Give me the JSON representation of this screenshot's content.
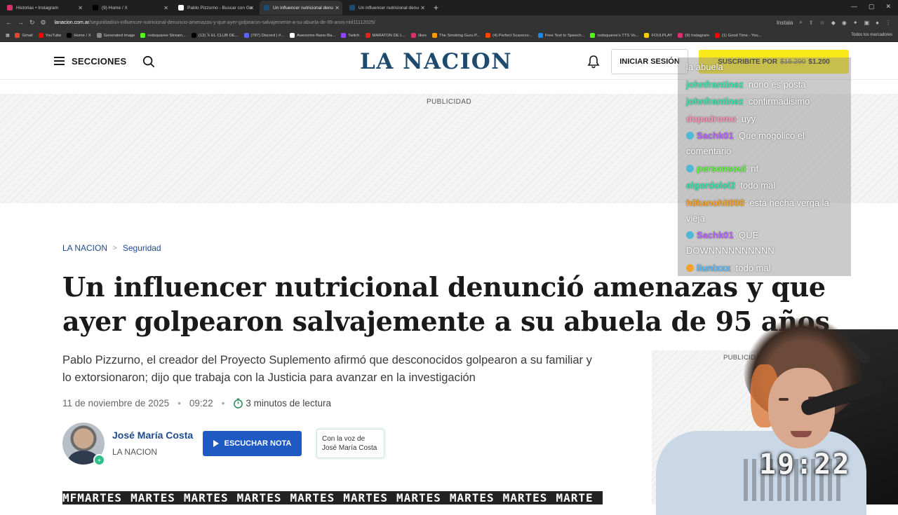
{
  "browser": {
    "tabs": [
      {
        "label": "Historias • Instagram",
        "color": "#d6306e"
      },
      {
        "label": "(9) Home / X",
        "color": "#000000"
      },
      {
        "label": "Pablo Pizzurno - Buscar con Go",
        "color": "#ffffff"
      },
      {
        "label": "Un influencer nutricional denu",
        "color": "#1e4a6e",
        "active": true
      },
      {
        "label": "Un influencer nutricional denu",
        "color": "#1e4a6e"
      }
    ],
    "new_tab": "+",
    "url_host": "lanacion.com.ar",
    "url_path": "/seguridad/un-influencer-nutricional-denuncio-amenazas-y-que-ayer-golpearon-salvajemente-a-su-abuela-de-95-anos-nid11112025/",
    "install_label": "Instala",
    "bookmarks": [
      {
        "label": "Gmail",
        "color": "#ea4335"
      },
      {
        "label": "YouTube",
        "color": "#ff0000"
      },
      {
        "label": "Home / X",
        "color": "#000000"
      },
      {
        "label": "Generated image",
        "color": "#888888"
      },
      {
        "label": "rodsquaree Stream...",
        "color": "#53fc18"
      },
      {
        "label": "(13) 𝕏 EL CLUB DE...",
        "color": "#000000"
      },
      {
        "label": "(787) Discord | #...",
        "color": "#5865f2"
      },
      {
        "label": "Awesome-Nano-Ba...",
        "color": "#ffffff"
      },
      {
        "label": "Twitch",
        "color": "#9146ff"
      },
      {
        "label": "MARATON DE L...",
        "color": "#e2231a"
      },
      {
        "label": "likes",
        "color": "#d6306e"
      },
      {
        "label": "The Smoking Guru P...",
        "color": "#ff9900"
      },
      {
        "label": "(4) Perfect Scarecro...",
        "color": "#ff4500"
      },
      {
        "label": "Free Text to Speech...",
        "color": "#1e88e5"
      },
      {
        "label": "rodsquaree's TTS Vo...",
        "color": "#53fc18"
      },
      {
        "label": "FOULPLAY",
        "color": "#ffcc00"
      },
      {
        "label": "(9) Instagram",
        "color": "#d6306e"
      },
      {
        "label": "(1) Good Time - You...",
        "color": "#ff0000"
      }
    ],
    "all_bookmarks": "Todos los marcadores"
  },
  "header": {
    "sections_label": "SECCIONES",
    "logo": "LA NACION",
    "login_label": "INICIAR SESIÓN",
    "subscribe_label": "SUSCRIBITE POR",
    "subscribe_old_price": "$15.290",
    "subscribe_price": "$1.200"
  },
  "ad": {
    "label": "PUBLICIDAD",
    "side_label": "PUBLICIDAD"
  },
  "article": {
    "breadcrumb": [
      "LA NACION",
      "Seguridad"
    ],
    "title": "Un influencer nutricional denunció amenazas y que ayer golpearon salvajemente a su abuela de 95 años",
    "subtitle": "Pablo Pizzurno, el creador del Proyecto Suplemento afirmó que desconocidos golpearon a su familiar y lo extorsionaron; dijo que trabaja con la Justicia para avanzar en la investigación",
    "date": "11 de noviembre de 2025",
    "time": "09:22",
    "reading_time": "3 minutos de lectura",
    "author_name": "José María Costa",
    "author_org": "LA NACION",
    "listen_label": "ESCUCHAR NOTA",
    "voice_line1": "Con la voz de",
    "voice_line2": "José María Costa",
    "ticker_words": [
      "MFMARTES",
      "MARTES",
      "MARTES",
      "MARTES",
      "MARTES",
      "MARTES",
      "MARTES",
      "MARTES",
      "MARTES",
      "MARTE"
    ]
  },
  "chat": {
    "messages": [
      {
        "user": "",
        "text": "la abuela",
        "color": "#ffffff"
      },
      {
        "user": "johnfrantinez",
        "text": ": nono es posta",
        "color": "#2ee8a8"
      },
      {
        "user": "johnfrantinez",
        "text": ": confirmadisimo",
        "color": "#2ee8a8"
      },
      {
        "user": "dopadromo",
        "text": ": uyy",
        "color": "#ff8fb5"
      },
      {
        "user": "Sachk01",
        "text": ": Que mogolico el comentario",
        "color": "#b55cff",
        "badge": "mod"
      },
      {
        "user": "personsoul",
        "text": ": nt",
        "color": "#5aff3a",
        "badge": "mod"
      },
      {
        "user": "elgordolol2",
        "text": ": todo mal",
        "color": "#2ee8a8"
      },
      {
        "user": "h0kanohit000",
        "text": ": está hecha verga la vieja",
        "color": "#ffa21a"
      },
      {
        "user": "Sachk01",
        "text": ": QUE DOWNNNNNNNNNN",
        "color": "#b55cff",
        "badge": "mod"
      },
      {
        "user": "liunixxx",
        "text": ": todo mal",
        "color": "#4fb7ff",
        "badge": "emoji"
      }
    ]
  },
  "overlay": {
    "clock": "19:22"
  }
}
